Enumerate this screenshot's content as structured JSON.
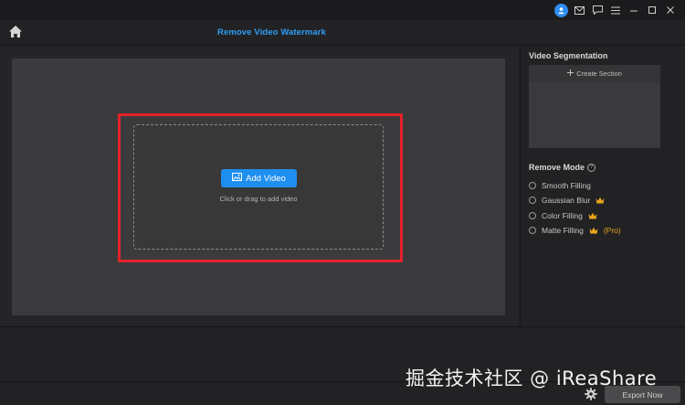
{
  "header": {
    "title": "Remove Video Watermark"
  },
  "titlebar": {
    "icons": [
      "user-avatar-icon",
      "mail-icon",
      "chat-icon",
      "menu-icon",
      "minimize-icon",
      "maximize-icon",
      "close-icon"
    ]
  },
  "main": {
    "add_button_label": "Add Video",
    "hint": "Click or drag to add video"
  },
  "side": {
    "segmentation_title": "Video Segmentation",
    "create_section_label": "Create Section",
    "remove_mode_title": "Remove Mode",
    "modes": [
      {
        "label": "Smooth Filling",
        "premium": false
      },
      {
        "label": "Gaussian Blur",
        "premium": true
      },
      {
        "label": "Color Filling",
        "premium": true
      },
      {
        "label": "Matte Filling",
        "premium": true,
        "tag": "(Pro)"
      }
    ]
  },
  "footer": {
    "watermark": "掘金技术社区 @ iReaShare",
    "export_label": "Export Now"
  },
  "colors": {
    "accent": "#1e8ff0",
    "highlight": "#e5222b",
    "crown": "#e9a51a"
  }
}
